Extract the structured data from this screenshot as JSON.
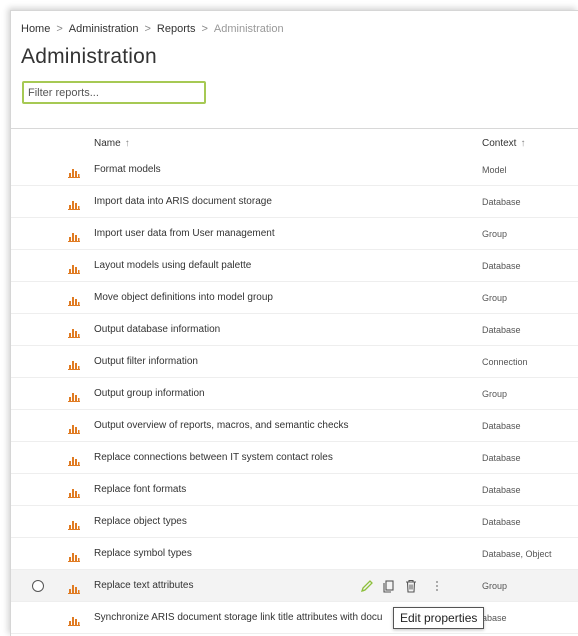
{
  "breadcrumb": {
    "items": [
      "Home",
      "Administration",
      "Reports"
    ],
    "current": "Administration",
    "separator": ">"
  },
  "page": {
    "title": "Administration"
  },
  "filter": {
    "placeholder": "Filter reports...",
    "value": ""
  },
  "table": {
    "columns": {
      "name": "Name",
      "context": "Context",
      "sort_indicator": "↑"
    },
    "rows": [
      {
        "name": "Format models",
        "context": "Model"
      },
      {
        "name": "Import data into ARIS document storage",
        "context": "Database"
      },
      {
        "name": "Import user data from User management",
        "context": "Group"
      },
      {
        "name": "Layout models using default palette",
        "context": "Database"
      },
      {
        "name": "Move object definitions into model group",
        "context": "Group"
      },
      {
        "name": "Output database information",
        "context": "Database"
      },
      {
        "name": "Output filter information",
        "context": "Connection"
      },
      {
        "name": "Output group information",
        "context": "Group"
      },
      {
        "name": "Output overview of reports, macros, and semantic checks",
        "context": "Database"
      },
      {
        "name": "Replace connections between IT system contact roles",
        "context": "Database"
      },
      {
        "name": "Replace font formats",
        "context": "Database"
      },
      {
        "name": "Replace object types",
        "context": "Database"
      },
      {
        "name": "Replace symbol types",
        "context": "Database, Object"
      },
      {
        "name": "Replace text attributes",
        "context": "Group"
      },
      {
        "name": "Synchronize ARIS document storage link title attributes with docu",
        "context": "abase"
      }
    ]
  },
  "tooltip": {
    "text": "Edit properties"
  },
  "colors": {
    "accent": "#a6c954",
    "report_icon": "#e07b22",
    "edit_icon": "#8dbf3c"
  },
  "icons": [
    "report-icon",
    "pencil-icon",
    "copy-icon",
    "trash-icon",
    "more-icon"
  ]
}
